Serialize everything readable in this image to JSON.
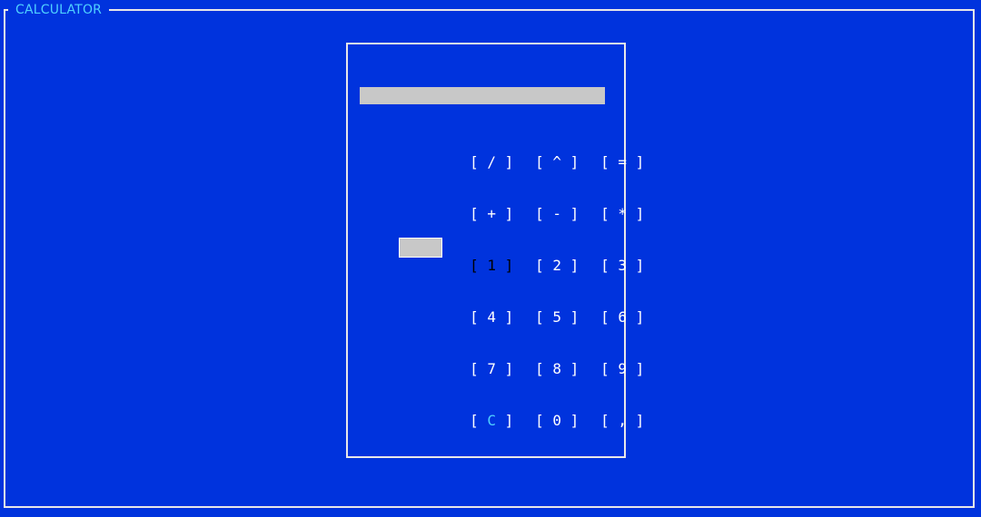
{
  "app": {
    "title": "CALCULATOR"
  },
  "display": {
    "value": ""
  },
  "keys": {
    "row0": [
      "/",
      "^",
      "="
    ],
    "row1": [
      "+",
      "-",
      "*"
    ],
    "row2": [
      "1",
      "2",
      "3"
    ],
    "row3": [
      "4",
      "5",
      "6"
    ],
    "row4": [
      "7",
      "8",
      "9"
    ],
    "row5": [
      "C",
      "0",
      ","
    ]
  },
  "bracket_open": "[",
  "bracket_close": "]",
  "focused_key": "1",
  "colors": {
    "background": "#0033dd",
    "border": "#e8e8e8",
    "title": "#4fd1ff",
    "display_bg": "#c8c8c8",
    "key_text": "#ffffff",
    "accent_key": "#4fd1ff"
  }
}
